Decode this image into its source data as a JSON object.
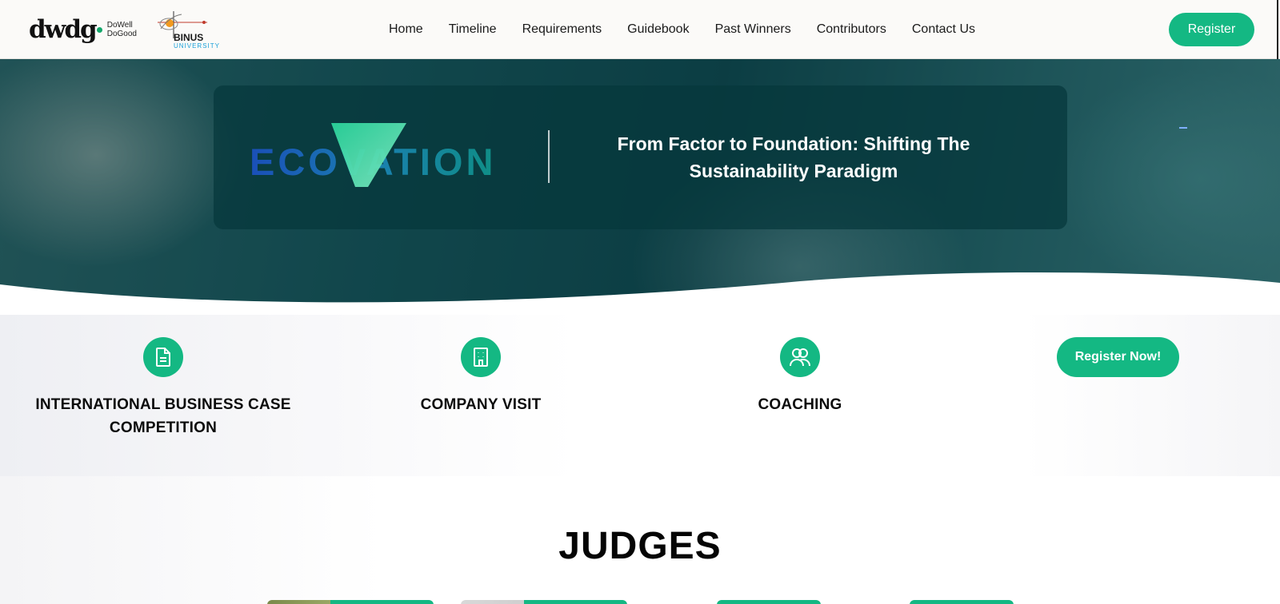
{
  "brand": {
    "dwdg_logo": "dwdg",
    "dwdg_line1": "DoWell",
    "dwdg_line2": "DoGood",
    "binus_name": "BINUS",
    "binus_sub": "UNIVERSITY"
  },
  "nav": {
    "links": [
      "Home",
      "Timeline",
      "Requirements",
      "Guidebook",
      "Past Winners",
      "Contributors",
      "Contact Us"
    ],
    "register_label": "Register"
  },
  "hero": {
    "logo_text": "ECOVATION",
    "tagline_line1": "From Factor to Foundation: Shifting The",
    "tagline_line2": "Sustainability Paradigm"
  },
  "features": [
    {
      "icon": "document-icon",
      "title_line1": "INTERNATIONAL BUSINESS CASE",
      "title_line2": "COMPETITION"
    },
    {
      "icon": "building-icon",
      "title_line1": "COMPANY VISIT",
      "title_line2": ""
    },
    {
      "icon": "users-icon",
      "title_line1": "COACHING",
      "title_line2": ""
    }
  ],
  "cta": {
    "register_now": "Register Now!"
  },
  "judges": {
    "title": "JUDGES"
  },
  "colors": {
    "accent": "#14b883",
    "hero_teal": "#0e3a40",
    "eco_blue": "#1e5fb8",
    "eco_green": "#2fc98f"
  }
}
